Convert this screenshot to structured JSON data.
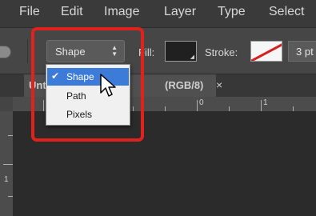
{
  "menu": [
    "File",
    "Edit",
    "Image",
    "Layer",
    "Type",
    "Select"
  ],
  "options_bar": {
    "mode_value": "Shape",
    "fill_label": "Fill:",
    "stroke_label": "Stroke:",
    "stroke_width_value": "3 pt"
  },
  "document_tab": {
    "title": "Unt",
    "mode": "(RGB/8)",
    "close_glyph": "×"
  },
  "ruler": {
    "top_labels": [
      "0",
      "1"
    ],
    "left_label": "1"
  },
  "mode_dropdown": {
    "items": [
      {
        "label": "Shape",
        "selected": true
      },
      {
        "label": "Path",
        "selected": false
      },
      {
        "label": "Pixels",
        "selected": false
      }
    ],
    "check_glyph": "✔"
  },
  "colors": {
    "highlight": "#e0221c",
    "selection": "#3d7bd8",
    "fill_swatch": "#202020",
    "stroke_swatch": "#f6f6f6"
  },
  "icons": [
    "tool-preset-icon",
    "chevron-updown-icon",
    "swatch-caret-icon",
    "no-stroke-slash-icon",
    "close-icon",
    "checkmark-icon",
    "mouse-pointer-icon"
  ]
}
